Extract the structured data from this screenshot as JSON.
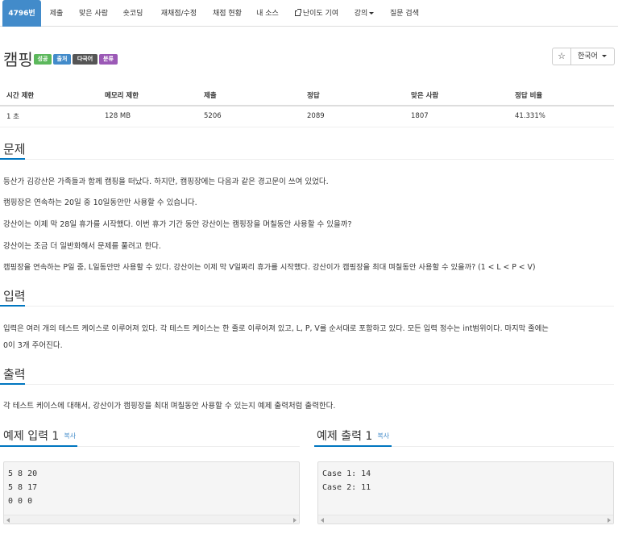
{
  "nav": {
    "problem_id": "4796번",
    "submit": "제출",
    "solvers": "맞은 사람",
    "shortest": "숏코딩",
    "rejudge": "재채점/수정",
    "status": "채점 현황",
    "my_source": "내 소스",
    "difficulty": "난이도 기여",
    "lecture": "강의",
    "questions": "질문 검색"
  },
  "problem": {
    "title": "캠핑",
    "labels": [
      {
        "text": "성공",
        "color": "#5cb85c"
      },
      {
        "text": "출처",
        "color": "#428bca"
      },
      {
        "text": "다국어",
        "color": "#555555"
      },
      {
        "text": "분류",
        "color": "#9b59b6"
      }
    ],
    "star": "☆",
    "language": "한국어"
  },
  "info_table": {
    "headers": [
      "시간 제한",
      "메모리 제한",
      "제출",
      "정답",
      "맞은 사람",
      "정답 비율"
    ],
    "row": [
      "1 초",
      "128 MB",
      "5206",
      "2089",
      "1807",
      "41.331%"
    ]
  },
  "sections": {
    "description_title": "문제",
    "description": [
      "등산가 김강산은 가족들과 함께 캠핑을 떠났다. 하지만, 캠핑장에는 다음과 같은 경고문이 쓰여 있었다.",
      "캠핑장은 연속하는 20일 중 10일동안만 사용할 수 있습니다.",
      "강산이는 이제 막 28일 휴가를 시작했다. 이번 휴가 기간 동안 강산이는 캠핑장을 며칠동안 사용할 수 있을까?",
      "강산이는 조금 더 일반화해서 문제를 풀려고 한다.",
      "캠핑장을 연속하는 P일 중, L일동안만 사용할 수 있다. 강산이는 이제 막 V일짜리 휴가를 시작했다. 강산이가 캠핑장을 최대 며칠동안 사용할 수 있을까? (1 < L < P < V)"
    ],
    "input_title": "입력",
    "input_line1": "입력은 여러 개의 테스트 케이스로 이루어져 있다. 각 테스트 케이스는 한 줄로 이루어져 있고, L, P, V를 순서대로 포함하고 있다. 모든 입력 정수는 int범위이다. 마지막 줄에는",
    "input_line2": "0이 3개 주어진다.",
    "output_title": "출력",
    "output": "각 테스트 케이스에 대해서, 강산이가 캠핑장을 최대 며칠동안 사용할 수 있는지 예제 출력처럼 출력한다."
  },
  "samples": {
    "input_title": "예제 입력 1",
    "output_title": "예제 출력 1",
    "copy": "복사",
    "input_lines": [
      "5 8 20",
      "5 8 17",
      "0 0 0"
    ],
    "output_lines": [
      "Case 1: 14",
      "Case 2: 11"
    ]
  }
}
